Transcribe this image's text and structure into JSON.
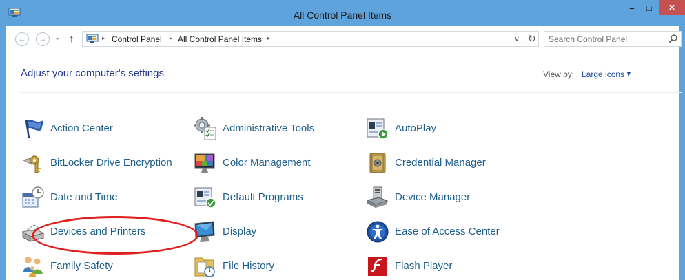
{
  "window": {
    "title": "All Control Panel Items",
    "min_glyph": "–",
    "max_glyph": "□",
    "close_glyph": "✕",
    "accent": "#5fa3dc",
    "close_color": "#c75050"
  },
  "address": {
    "breadcrumbs": [
      "Control Panel",
      "All Control Panel Items"
    ],
    "crumb_sep": "▸",
    "dropdown_glyph": "∨",
    "refresh_glyph": "↻",
    "back_glyph": "←",
    "forward_glyph": "→",
    "history_glyph": "▾",
    "up_glyph": "↑"
  },
  "search": {
    "placeholder": "Search Control Panel"
  },
  "header": {
    "title": "Adjust your computer's settings",
    "view_by_label": "View by:",
    "view_by_value": "Large icons",
    "view_by_caret": "▼"
  },
  "items": [
    {
      "label": "Action Center",
      "icon": "flag-icon"
    },
    {
      "label": "Administrative Tools",
      "icon": "admin-tools-icon"
    },
    {
      "label": "AutoPlay",
      "icon": "autoplay-icon"
    },
    {
      "label": "BitLocker Drive Encryption",
      "icon": "bitlocker-key-icon"
    },
    {
      "label": "Color Management",
      "icon": "color-management-icon"
    },
    {
      "label": "Credential Manager",
      "icon": "vault-icon"
    },
    {
      "label": "Date and Time",
      "icon": "calendar-clock-icon"
    },
    {
      "label": "Default Programs",
      "icon": "default-programs-icon"
    },
    {
      "label": "Device Manager",
      "icon": "device-manager-icon"
    },
    {
      "label": "Devices and Printers",
      "icon": "printer-icon"
    },
    {
      "label": "Display",
      "icon": "monitor-icon"
    },
    {
      "label": "Ease of Access Center",
      "icon": "ease-of-access-icon"
    },
    {
      "label": "Family Safety",
      "icon": "family-icon"
    },
    {
      "label": "File History",
      "icon": "file-history-icon"
    },
    {
      "label": "Flash Player",
      "icon": "flash-icon"
    }
  ],
  "highlight_color": "#e0201e",
  "link_color": "#1f5f8b"
}
